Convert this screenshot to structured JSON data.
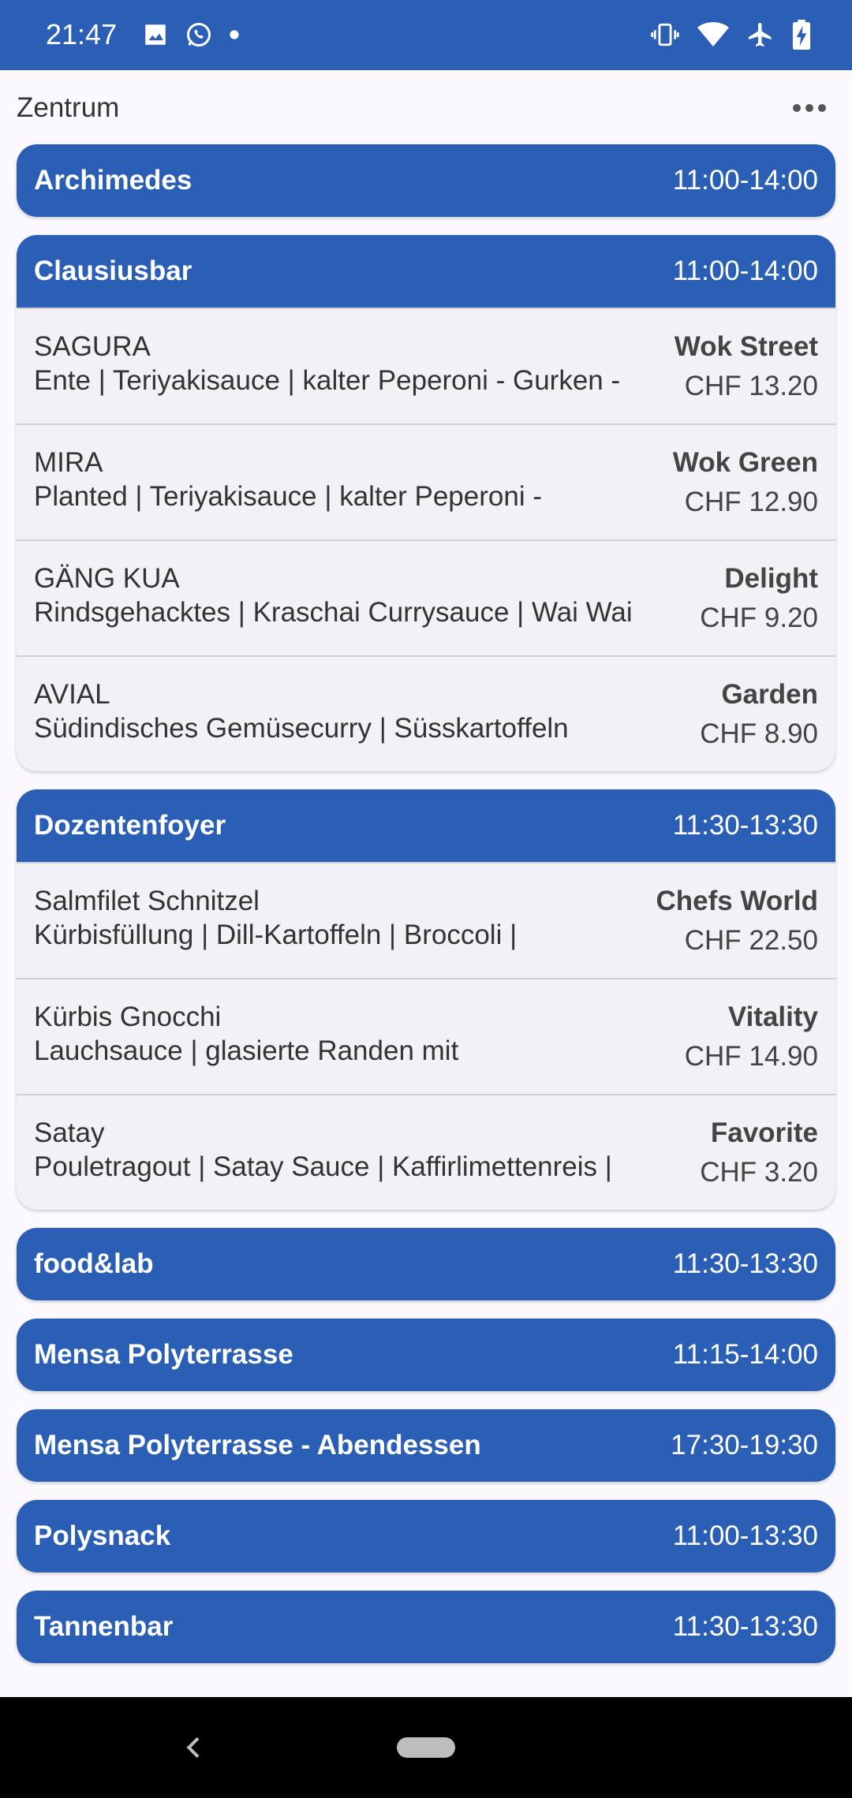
{
  "status_bar": {
    "time": "21:47",
    "left_icons": [
      "image-icon",
      "whatsapp-icon",
      "dot-icon"
    ],
    "right_icons": [
      "vibrate-icon",
      "wifi-icon",
      "airplane-icon",
      "battery-charging-icon"
    ]
  },
  "header": {
    "title": "Zentrum",
    "more_icon": "more-horizontal-icon"
  },
  "venues": [
    {
      "name": "Archimedes",
      "hours": "11:00-14:00",
      "items": []
    },
    {
      "name": "Clausiusbar",
      "hours": "11:00-14:00",
      "items": [
        {
          "name": "SAGURA",
          "description": "Ente | Teriyakisauce | kalter Peperoni - Gurken -",
          "line": "Wok Street",
          "price": "CHF 13.20"
        },
        {
          "name": "MIRA",
          "description": "Planted | Teriyakisauce | kalter Peperoni -",
          "line": "Wok Green",
          "price": "CHF 12.90"
        },
        {
          "name": "GÄNG KUA",
          "description": "Rindsgehacktes | Kraschai Currysauce | Wai Wai",
          "line": "Delight",
          "price": "CHF 9.20"
        },
        {
          "name": "AVIAL",
          "description": "Südindisches Gemüsecurry | Süsskartoffeln",
          "line": "Garden",
          "price": "CHF 8.90"
        }
      ]
    },
    {
      "name": "Dozentenfoyer",
      "hours": "11:30-13:30",
      "items": [
        {
          "name": "Salmfilet Schnitzel",
          "description": "Kürbisfüllung | Dill-Kartoffeln | Broccoli |",
          "line": "Chefs World",
          "price": "CHF 22.50"
        },
        {
          "name": "Kürbis Gnocchi",
          "description": "Lauchsauce | glasierte Randen mit",
          "line": "Vitality",
          "price": "CHF 14.90"
        },
        {
          "name": "Satay",
          "description": "Pouletragout | Satay Sauce | Kaffirlimettenreis |",
          "line": "Favorite",
          "price": "CHF 3.20"
        }
      ]
    },
    {
      "name": "food&lab",
      "hours": "11:30-13:30",
      "items": []
    },
    {
      "name": "Mensa Polyterrasse",
      "hours": "11:15-14:00",
      "items": []
    },
    {
      "name": "Mensa Polyterrasse - Abendessen",
      "hours": "17:30-19:30",
      "items": []
    },
    {
      "name": "Polysnack",
      "hours": "11:00-13:30",
      "items": []
    },
    {
      "name": "Tannenbar",
      "hours": "11:30-13:30",
      "items": []
    }
  ],
  "nav_bar": {
    "back_icon": "back-chevron-icon",
    "home_icon": "home-pill-icon"
  },
  "colors": {
    "primary": "#2a5fb5",
    "background": "#fbf9fd",
    "card_body": "#f1f1f6",
    "text": "#333333",
    "nav_bar": "#000000"
  }
}
